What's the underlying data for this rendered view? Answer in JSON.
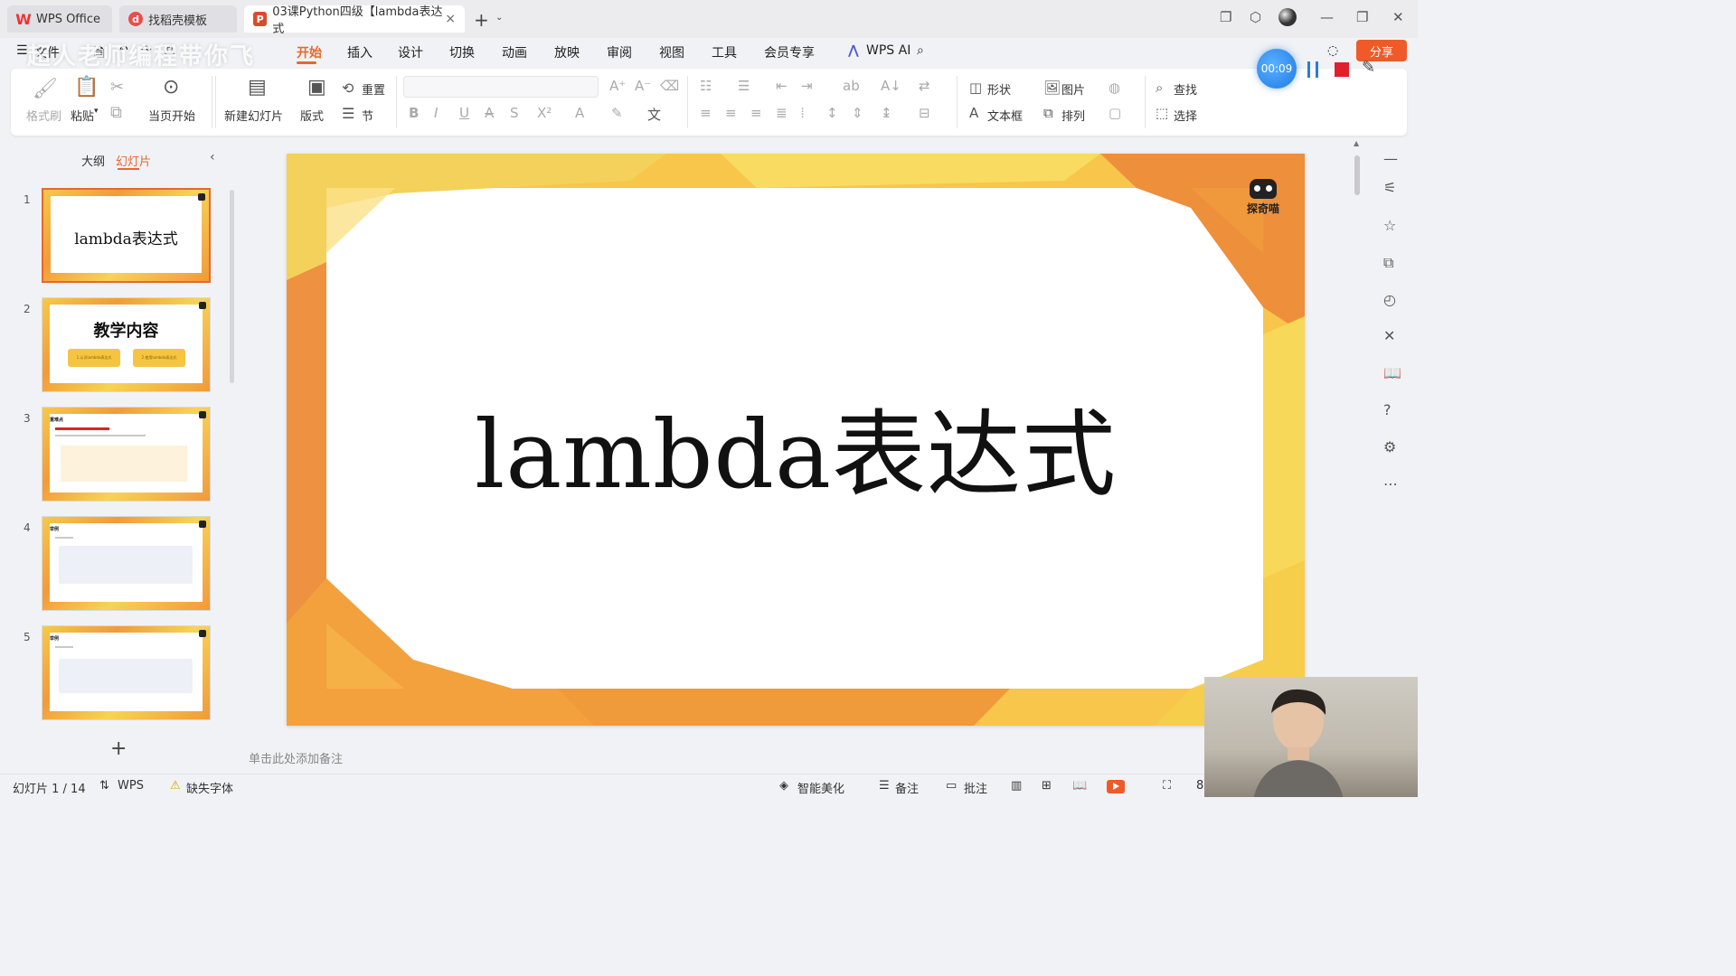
{
  "window": {
    "tabs": [
      {
        "label": "WPS Office",
        "icon": "wps-logo-icon"
      },
      {
        "label": "找稻壳模板",
        "icon": "docer-icon"
      },
      {
        "label": "03课Python四级【lambda表达式",
        "icon": "presentation-file-icon",
        "close": "×"
      }
    ],
    "new_tab": "+",
    "tab_menu": "⌄"
  },
  "menu": {
    "hamburger": "☰",
    "file": "文件",
    "items": [
      "开始",
      "插入",
      "设计",
      "切换",
      "动画",
      "放映",
      "审阅",
      "视图",
      "工具",
      "会员专享"
    ],
    "active": "开始",
    "wps_ai": "WPS AI",
    "share": "分享",
    "watermark": "超人老师编程带你飞"
  },
  "ribbon": {
    "format_painter": "格式刷",
    "paste": "粘贴",
    "play_from_current": "当页开始",
    "new_slide": "新建幻灯片",
    "layout": "版式",
    "reset": "重置",
    "section": "节",
    "shape": "形状",
    "picture": "图片",
    "textbox": "文本框",
    "arrange": "排列",
    "find": "查找",
    "select": "选择"
  },
  "recorder": {
    "timer": "00:09",
    "accent_color": "#1e7ae6",
    "stop_color": "#e0202a"
  },
  "panel": {
    "tab_outline": "大纲",
    "tab_slides": "幻灯片",
    "add_slide": "+"
  },
  "slides": [
    {
      "number": "1",
      "title": "lambda表达式",
      "selected": true
    },
    {
      "number": "2",
      "title": "教学内容",
      "pill1": "1.认识lambda表达式",
      "pill2": "2.使用lambda表达式"
    },
    {
      "number": "3",
      "head": "重难点"
    },
    {
      "number": "4",
      "head": "举例"
    },
    {
      "number": "5",
      "head": "举例"
    }
  ],
  "current_slide": {
    "title": "lambda表达式",
    "logo_text": "探奇喵"
  },
  "notes_placeholder": "单击此处添加备注",
  "status": {
    "slide_counter": "幻灯片 1 / 14",
    "wps": "WPS",
    "missing_font": "缺失字体",
    "smart_beautify": "智能美化",
    "notes": "备注",
    "comment": "批注",
    "zoom_partial": "8"
  },
  "colors": {
    "accent": "#e6682e",
    "share": "#f05a28",
    "frame_orange": "#f1993a",
    "frame_yellow": "#f7d356"
  }
}
